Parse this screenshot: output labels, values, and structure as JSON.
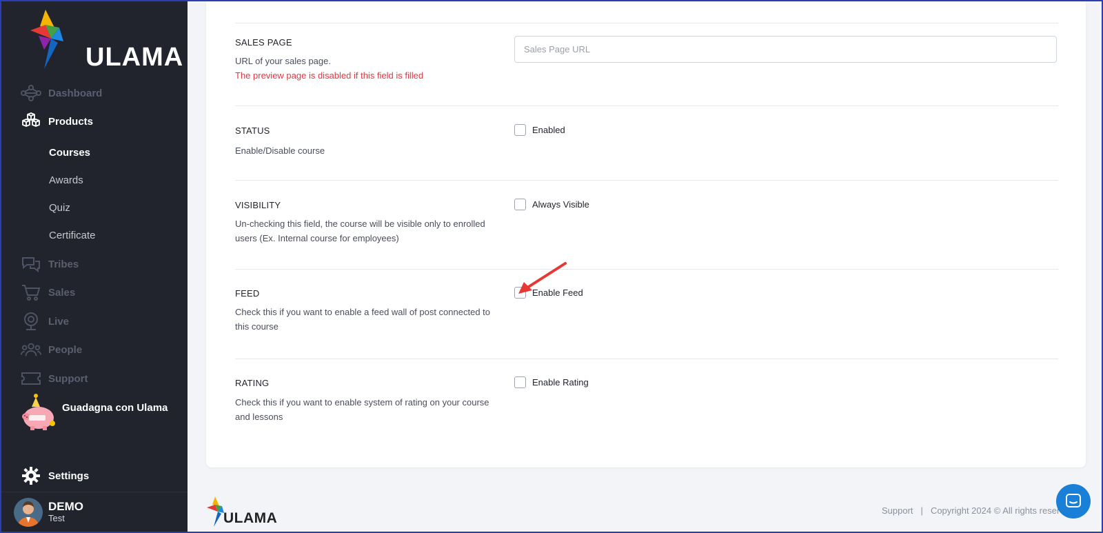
{
  "brand": {
    "name": "ULAMA"
  },
  "sidebar": {
    "items": [
      {
        "label": "Dashboard",
        "icon": "network-icon"
      },
      {
        "label": "Products",
        "icon": "cubes-icon",
        "active": true
      },
      {
        "label": "Tribes",
        "icon": "chat-bubbles-icon"
      },
      {
        "label": "Sales",
        "icon": "cart-icon"
      },
      {
        "label": "Live",
        "icon": "webcam-icon"
      },
      {
        "label": "People",
        "icon": "people-icon"
      },
      {
        "label": "Support",
        "icon": "ticket-icon"
      }
    ],
    "products_sub": [
      "Courses",
      "Awards",
      "Quiz",
      "Certificate"
    ],
    "promo_label": "Guadagna con Ulama",
    "settings_label": "Settings",
    "user": {
      "name": "DEMO",
      "sub": "Test"
    }
  },
  "form": {
    "sales_page": {
      "title": "SALES PAGE",
      "desc": "URL of your sales page.",
      "warning": "The preview page is disabled if this field is filled",
      "placeholder": "Sales Page URL",
      "value": ""
    },
    "status": {
      "title": "STATUS",
      "desc": "Enable/Disable course",
      "check_label": "Enabled",
      "checked": false
    },
    "visibility": {
      "title": "VISIBILITY",
      "desc": "Un-checking this field, the course will be visible only to enrolled users (Ex. Internal course for employees)",
      "check_label": "Always Visible",
      "checked": false
    },
    "feed": {
      "title": "FEED",
      "desc": "Check this if you want to enable a feed wall of post connected to this course",
      "check_label": "Enable Feed",
      "checked": false
    },
    "rating": {
      "title": "RATING",
      "desc": "Check this if you want to enable system of rating on your course and lessons",
      "check_label": "Enable Rating",
      "checked": false
    }
  },
  "footer": {
    "brand": "ULAMA",
    "support": "Support",
    "separator": "|",
    "copyright": "Copyright 2024 © All rights reserved"
  },
  "colors": {
    "sidebar_bg": "#21232d",
    "warning": "#e5343f",
    "chat": "#1a7fd6",
    "annotation_arrow": "#e53935"
  }
}
